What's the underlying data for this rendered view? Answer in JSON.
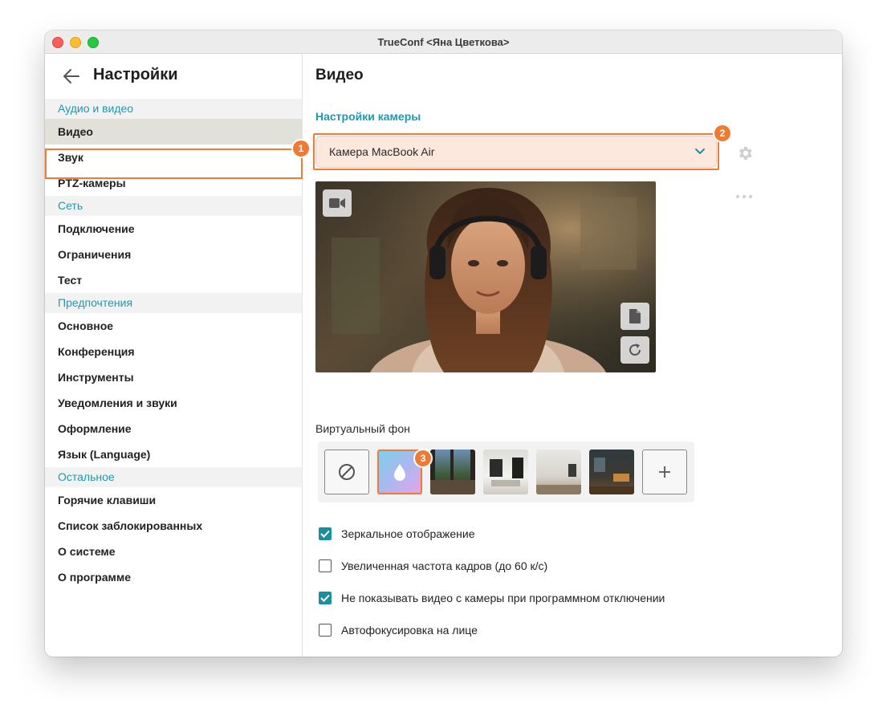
{
  "window": {
    "title": "TrueConf <Яна Цветкова>"
  },
  "sidebar": {
    "title": "Настройки",
    "sections": [
      {
        "label": "Аудио и видео",
        "items": [
          {
            "label": "Видео",
            "active": true
          },
          {
            "label": "Звук"
          },
          {
            "label": "PTZ-камеры"
          }
        ]
      },
      {
        "label": "Сеть",
        "items": [
          {
            "label": "Подключение"
          },
          {
            "label": "Ограничения"
          },
          {
            "label": "Тест"
          }
        ]
      },
      {
        "label": "Предпочтения",
        "items": [
          {
            "label": "Основное"
          },
          {
            "label": "Конференция"
          },
          {
            "label": "Инструменты"
          },
          {
            "label": "Уведомления и звуки"
          },
          {
            "label": "Оформление"
          },
          {
            "label": "Язык (Language)"
          }
        ]
      },
      {
        "label": "Остальное",
        "items": [
          {
            "label": "Горячие клавиши"
          },
          {
            "label": "Список заблокированных"
          },
          {
            "label": "О системе"
          },
          {
            "label": "О программе"
          }
        ]
      }
    ]
  },
  "main": {
    "title": "Видео",
    "camera_section": "Настройки камеры",
    "camera_value": "Камера MacBook Air",
    "virtual_bg_label": "Виртуальный фон",
    "checkboxes": [
      {
        "label": "Зеркальное отображение",
        "checked": true
      },
      {
        "label": "Увеличенная частота кадров (до 60 к/с)",
        "checked": false
      },
      {
        "label": "Не показывать видео с камеры при программном отключении",
        "checked": true
      },
      {
        "label": "Автофокусировка на лице",
        "checked": false
      }
    ]
  },
  "badges": {
    "b1": "1",
    "b2": "2",
    "b3": "3"
  },
  "colors": {
    "accent": "#1a9bb0",
    "highlight": "#ee7a33",
    "check": "#1a8fa1"
  },
  "icons": [
    "back-arrow-icon",
    "chevron-down-icon",
    "gear-icon",
    "more-dots-icon",
    "camera-icon",
    "file-icon",
    "rotate-icon",
    "none-icon",
    "blur-drop-icon",
    "plus-icon"
  ]
}
